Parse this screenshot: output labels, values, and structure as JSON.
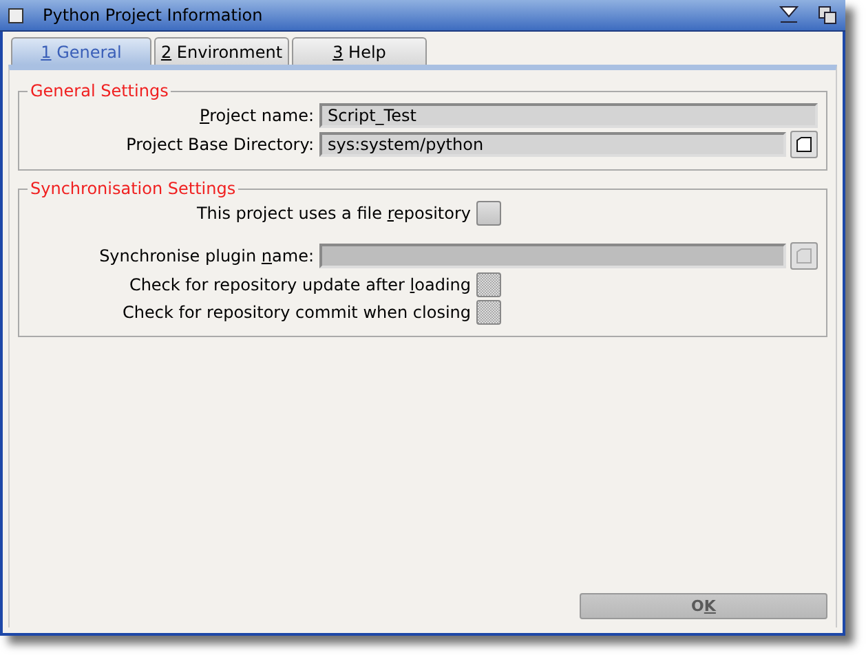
{
  "window": {
    "title": "Python Project Information"
  },
  "tabs": [
    {
      "label": {
        "key": "1",
        "after": " General"
      },
      "selected": true
    },
    {
      "label": {
        "key": "2",
        "after": " Environment"
      },
      "selected": false
    },
    {
      "label": {
        "key": "3",
        "after": " Help"
      },
      "selected": false
    }
  ],
  "groups": [
    {
      "title": "General Settings",
      "rows": [
        {
          "kind": "field",
          "label": {
            "key": "P",
            "after": "roject name:"
          },
          "value": "Script_Test",
          "disabled": false,
          "has_button": false
        },
        {
          "kind": "field",
          "label": {
            "before": "Project Base Directory:"
          },
          "value": "sys:system/python",
          "disabled": false,
          "has_button": true
        }
      ]
    },
    {
      "title": "Synchronisation Settings",
      "rows": [
        {
          "kind": "checkbox",
          "label": {
            "before": "This project uses a file ",
            "key": "r",
            "after": "epository"
          },
          "checked": false,
          "disabled": false
        },
        {
          "kind": "field",
          "label": {
            "before": "Synchronise plugin ",
            "key": "n",
            "after": "ame:"
          },
          "disabled": true,
          "has_button": true
        },
        {
          "kind": "checkbox",
          "label": {
            "before": "Check for repository update after ",
            "key": "l",
            "after": "oading"
          },
          "checked": false,
          "disabled": true
        },
        {
          "kind": "checkbox",
          "label": {
            "before": "Check for repository commit when closing"
          },
          "checked": false,
          "disabled": true
        }
      ]
    }
  ],
  "buttons": [
    {
      "label": {
        "before": "O",
        "key": "K"
      },
      "disabled": true
    }
  ]
}
